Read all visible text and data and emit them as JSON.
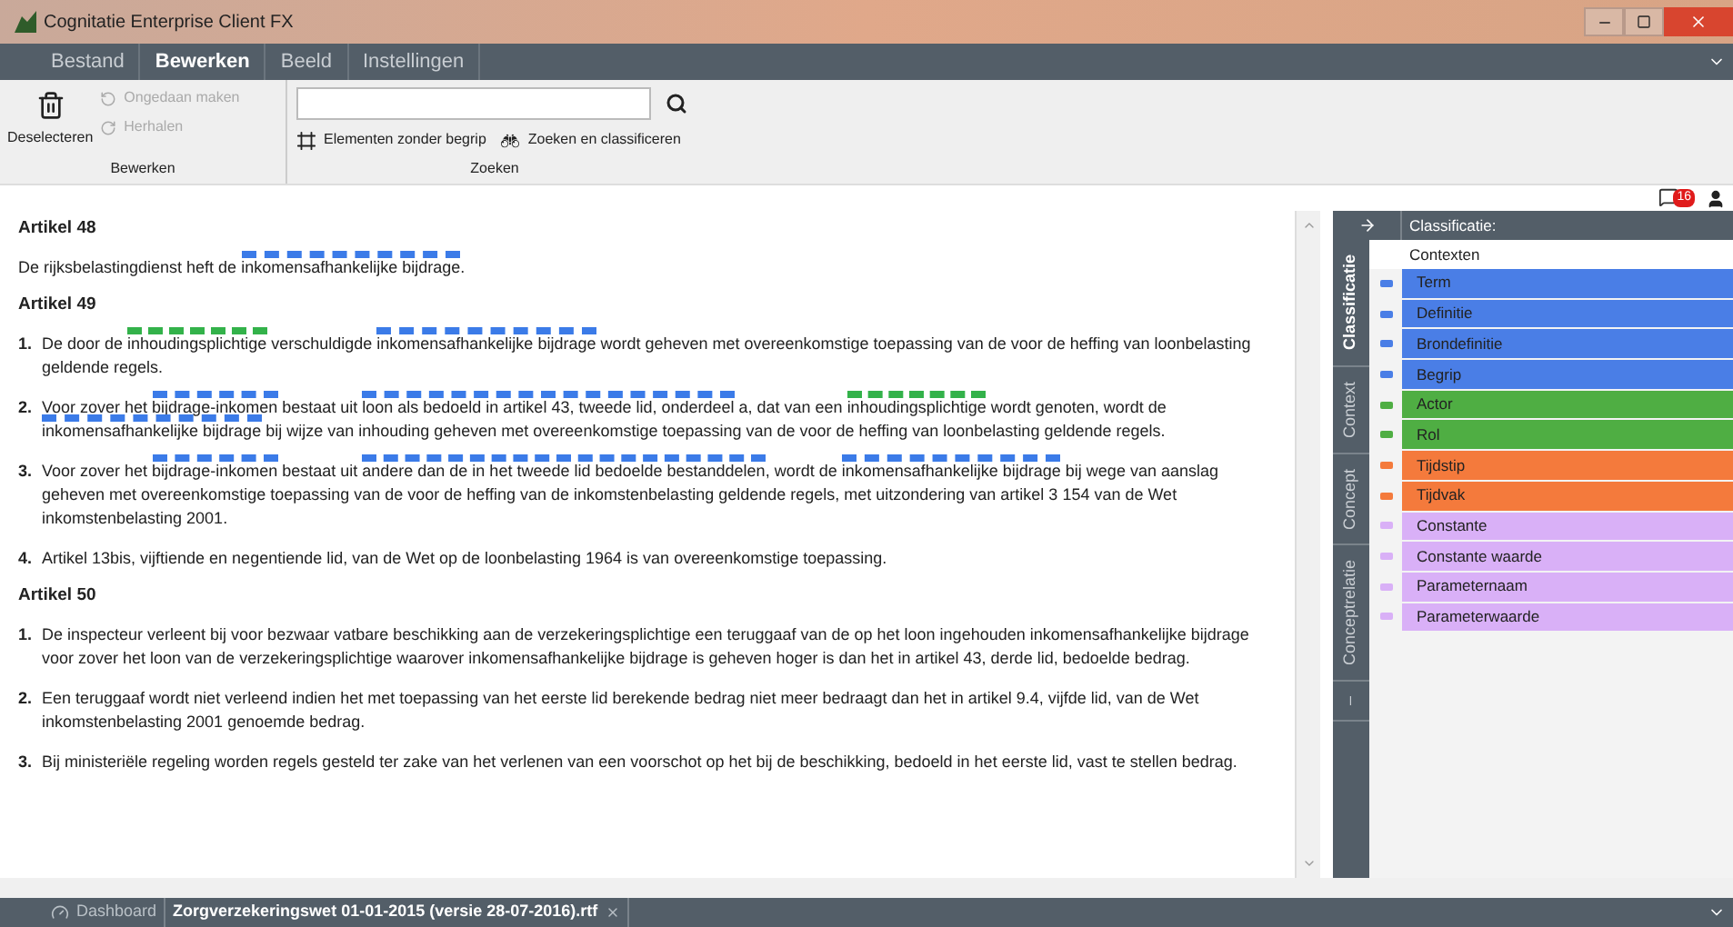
{
  "window": {
    "title": "Cognitatie Enterprise Client FX"
  },
  "menu": [
    {
      "label": "Bestand",
      "selected": false
    },
    {
      "label": "Bewerken",
      "selected": true
    },
    {
      "label": "Beeld",
      "selected": false
    },
    {
      "label": "Instellingen",
      "selected": false
    }
  ],
  "ribbon": {
    "groups": [
      {
        "label": "Bewerken",
        "big_button": "Deselecteren",
        "small_buttons": [
          {
            "label": "Ongedaan maken",
            "disabled": true,
            "kind": "undo"
          },
          {
            "label": "Herhalen",
            "disabled": true,
            "kind": "redo"
          }
        ]
      },
      {
        "label": "Zoeken",
        "buttons": [
          {
            "label": "Elementen zonder begrip",
            "kind": "elements"
          },
          {
            "label": "Zoeken en classificeren",
            "kind": "binoculars"
          }
        ]
      }
    ]
  },
  "notifications": {
    "count": "16"
  },
  "document": {
    "articles": [
      {
        "title": "Artikel 48",
        "paragraphs": [
          {
            "segments": [
              {
                "text": "De rijksbelastingdienst heft de "
              },
              {
                "text": "inkomensafhankelijke bijdrage",
                "color": "#3b7be8"
              },
              {
                "text": "."
              }
            ]
          }
        ]
      },
      {
        "title": "Artikel 49",
        "paragraphs": [
          {
            "number": "1.",
            "segments": [
              {
                "text": "De door de "
              },
              {
                "text": "inhoudingsplichtige",
                "color": "#33b24a"
              },
              {
                "text": " verschuldigde "
              },
              {
                "text": "inkomensafhankelijke bijdrage",
                "color": "#3b7be8"
              },
              {
                "text": " wordt geheven met overeenkomstige toepassing van de voor de heffing van loonbelasting geldende regels."
              }
            ]
          },
          {
            "number": "2.",
            "segments": [
              {
                "text": "Voor zover het "
              },
              {
                "text": "bijdrage-inkomen",
                "color": "#3b7be8"
              },
              {
                "text": " bestaat uit "
              },
              {
                "text": "loon als bedoeld in artikel 43, tweede lid, onderdeel",
                "color": "#3b7be8"
              },
              {
                "text": " a, dat van een "
              },
              {
                "text": "inhoudingsplichtige",
                "color": "#33b24a"
              },
              {
                "text": " wordt genoten, wordt de "
              },
              {
                "text": "inkomensafhankelijke bijdrage",
                "color": "#3b7be8"
              },
              {
                "text": " bij wijze van inhouding geheven met overeenkomstige toepassing van de voor de heffing van loonbelasting geldende regels."
              }
            ]
          },
          {
            "number": "3.",
            "segments": [
              {
                "text": "Voor zover het "
              },
              {
                "text": "bijdrage-inkomen",
                "color": "#3b7be8"
              },
              {
                "text": " bestaat uit "
              },
              {
                "text": "andere dan de in het tweede lid bedoelde bestanddelen",
                "color": "#3b7be8"
              },
              {
                "text": ", wordt de "
              },
              {
                "text": "inkomensafhankelijke bijdrage",
                "color": "#3b7be8"
              },
              {
                "text": " bij wege van aanslag geheven met overeenkomstige toepassing van de voor de heffing van de inkomstenbelasting geldende regels, met uitzondering van artikel 3 154 van de Wet inkomstenbelasting 2001."
              }
            ]
          },
          {
            "number": "4.",
            "segments": [
              {
                "text": "Artikel 13bis, vijftiende en negentiende lid, van de Wet op de loonbelasting 1964 is van overeenkomstige toepassing."
              }
            ]
          }
        ]
      },
      {
        "title": "Artikel 50",
        "paragraphs": [
          {
            "number": "1.",
            "segments": [
              {
                "text": "De inspecteur verleent bij voor bezwaar vatbare beschikking aan de verzekeringsplichtige een teruggaaf van de op het loon ingehouden inkomensafhankelijke bijdrage voor zover het loon van de verzekeringsplichtige waarover inkomensafhankelijke bijdrage is geheven hoger is dan het in artikel 43, derde lid, bedoelde bedrag."
              }
            ]
          },
          {
            "number": "2.",
            "segments": [
              {
                "text": "Een teruggaaf wordt niet verleend indien het met toepassing van het eerste lid berekende bedrag niet meer bedraagt dan het in artikel 9.4, vijfde lid, van de Wet inkomstenbelasting 2001 genoemde bedrag."
              }
            ]
          },
          {
            "number": "3.",
            "segments": [
              {
                "text": "Bij ministeriële regeling worden regels gesteld ter zake van het verlenen van een voorschot op het bij de beschikking, bedoeld in het eerste lid, vast te stellen bedrag."
              }
            ]
          }
        ]
      }
    ]
  },
  "classification_panel": {
    "header": "Classificatie:",
    "side_tabs": [
      {
        "label": "Classificatie",
        "selected": true
      },
      {
        "label": "Context",
        "selected": false
      },
      {
        "label": "Concept",
        "selected": false
      },
      {
        "label": "Conceptrelatie",
        "selected": false
      },
      {
        "label": "–",
        "selected": false
      }
    ],
    "group_label": "Contexten",
    "items": [
      {
        "label": "Term",
        "color": "#4a7ee6"
      },
      {
        "label": "Definitie",
        "color": "#4a7ee6"
      },
      {
        "label": "Brondefinitie",
        "color": "#4a7ee6"
      },
      {
        "label": "Begrip",
        "color": "#4a7ee6"
      },
      {
        "label": "Actor",
        "color": "#4fae43"
      },
      {
        "label": "Rol",
        "color": "#4fae43"
      },
      {
        "label": "Tijdstip",
        "color": "#f47a3c"
      },
      {
        "label": "Tijdvak",
        "color": "#f47a3c"
      },
      {
        "label": "Constante",
        "color": "#d9b0f7"
      },
      {
        "label": "Constante waarde",
        "color": "#d9b0f7"
      },
      {
        "label": "Parameternaam",
        "color": "#d9b0f7"
      },
      {
        "label": "Parameterwaarde",
        "color": "#d9b0f7"
      }
    ]
  },
  "bottom_tabs": [
    {
      "label": "Dashboard",
      "kind": "dashboard",
      "selected": false
    },
    {
      "label": "Zorgverzekeringswet 01-01-2015 (versie 28-07-2016).rtf",
      "kind": "document",
      "selected": true
    }
  ]
}
